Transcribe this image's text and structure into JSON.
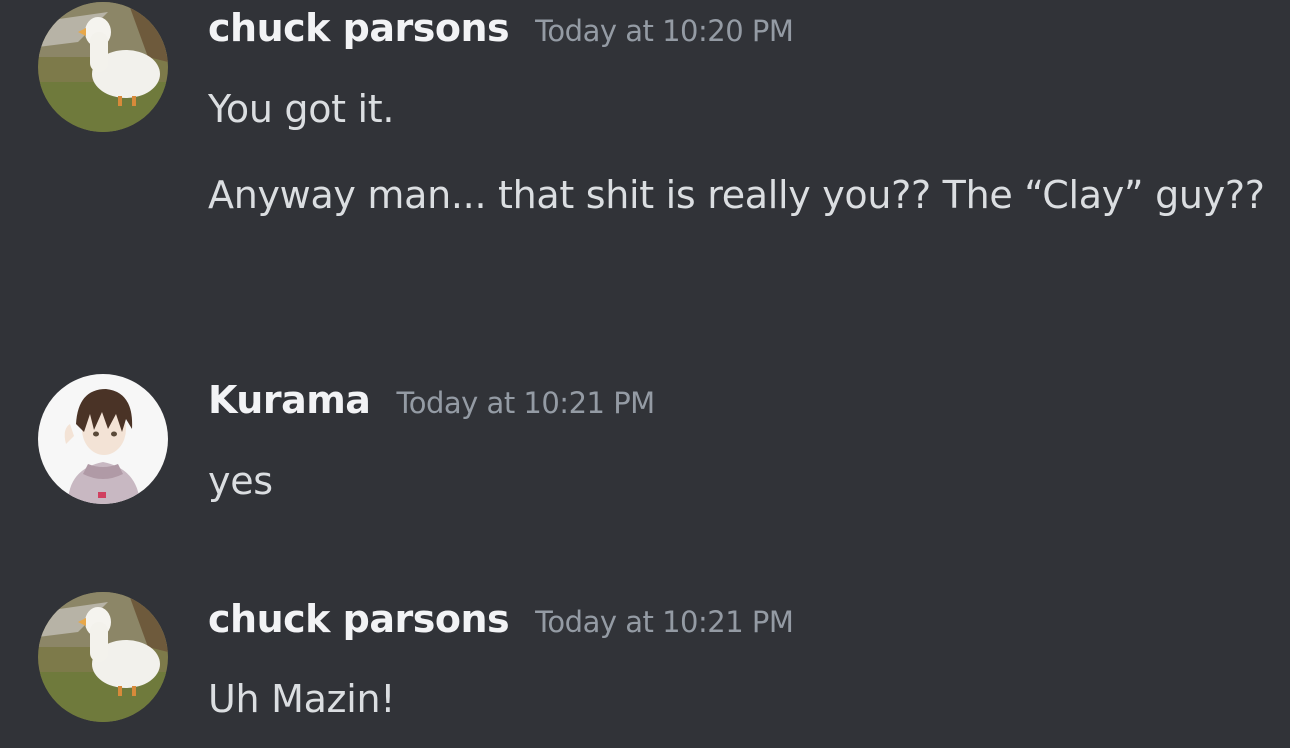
{
  "messages": [
    {
      "author": "chuck parsons",
      "timestamp": "Today at 10:20 PM",
      "avatar_icon": "duck-avatar",
      "lines": [
        "You got it.",
        "Anyway man... that shit is really you?? The “Clay” guy??"
      ]
    },
    {
      "author": "Kurama",
      "timestamp": "Today at 10:21 PM",
      "avatar_icon": "anime-boy-avatar",
      "lines": [
        "yes"
      ]
    },
    {
      "author": "chuck parsons",
      "timestamp": "Today at 10:21 PM",
      "avatar_icon": "duck-avatar",
      "lines": [
        "Uh Mazin!"
      ]
    }
  ],
  "colors": {
    "background": "#313338",
    "username": "#f2f3f5",
    "timestamp": "#949ba4",
    "text": "#dbdee1"
  }
}
